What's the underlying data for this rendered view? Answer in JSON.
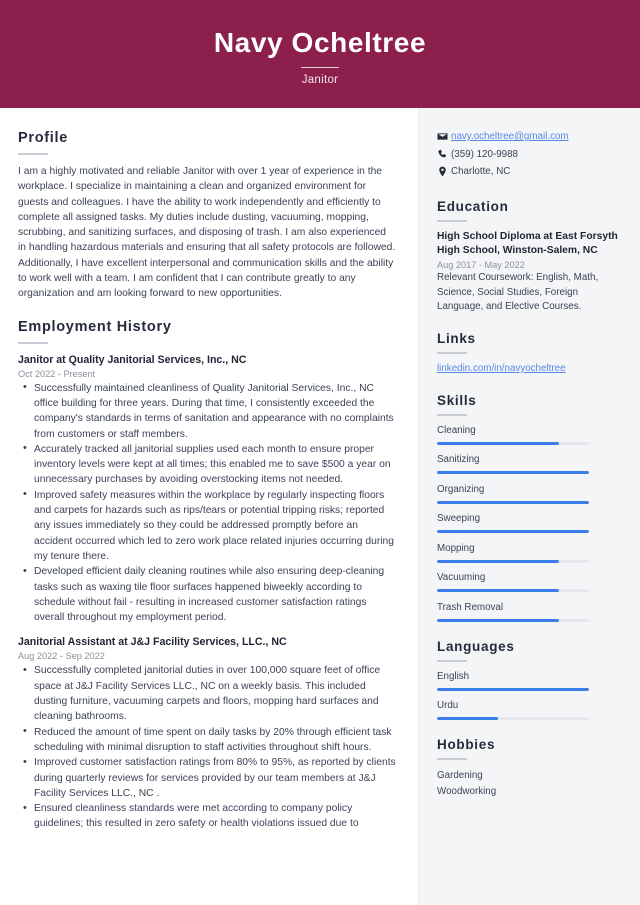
{
  "colors": {
    "header_band": "#8C1F4B",
    "accent_bar": "#3B7DEA",
    "bar_track": "#E5E7EA",
    "sidebar_bg": "#F4F5F7",
    "heading": "#262B3B",
    "body_text": "#3C4356",
    "muted_text": "#8C919E",
    "link": "#5588E6"
  },
  "header": {
    "name": "Navy Ocheltree",
    "role": "Janitor"
  },
  "main": {
    "profile": {
      "title": "Profile",
      "text": "I am a highly motivated and reliable Janitor with over 1 year of experience in the workplace. I specialize in maintaining a clean and organized environment for guests and colleagues. I have the ability to work independently and efficiently to complete all assigned tasks. My duties include dusting, vacuuming, mopping, scrubbing, and sanitizing surfaces, and disposing of trash. I am also experienced in handling hazardous materials and ensuring that all safety protocols are followed. Additionally, I have excellent interpersonal and communication skills and the ability to work well with a team. I am confident that I can contribute greatly to any organization and am looking forward to new opportunities."
    },
    "employment": {
      "title": "Employment History",
      "jobs": [
        {
          "title": "Janitor at Quality Janitorial Services, Inc., NC",
          "date": "Oct 2022 - Present",
          "bullets": [
            "Successfully maintained cleanliness of Quality Janitorial Services, Inc., NC office building for three years. During that time, I consistently exceeded the company's standards in terms of sanitation and appearance with no complaints from customers or staff members.",
            "Accurately tracked all janitorial supplies used each month to ensure proper inventory levels were kept at all times; this enabled me to save $500 a year on unnecessary purchases by avoiding overstocking items not needed.",
            "Improved safety measures within the workplace by regularly inspecting floors and carpets for hazards such as rips/tears or potential tripping risks; reported any issues immediately so they could be addressed promptly before an accident occurred which led to zero work place related injuries occurring during my tenure there.",
            "Developed efficient daily cleaning routines while also ensuring deep-cleaning tasks such as waxing tile floor surfaces happened biweekly according to schedule without fail - resulting in increased customer satisfaction ratings overall throughout my employment period."
          ]
        },
        {
          "title": "Janitorial Assistant at J&J Facility Services, LLC., NC",
          "date": "Aug 2022 - Sep 2022",
          "bullets": [
            "Successfully completed janitorial duties in over 100,000 square feet of office space at J&J Facility Services LLC., NC on a weekly basis. This included dusting furniture, vacuuming carpets and floors, mopping hard surfaces and cleaning bathrooms.",
            "Reduced the amount of time spent on daily tasks by 20% through efficient task scheduling with minimal disruption to staff activities throughout shift hours.",
            "Improved customer satisfaction ratings from 80% to 95%, as reported by clients during quarterly reviews for services provided by our team members at J&J Facility Services LLC., NC .",
            "Ensured cleanliness standards were met according to company policy guidelines; this resulted in zero safety or health violations issued due to"
          ]
        }
      ]
    }
  },
  "sidebar": {
    "contact": [
      {
        "icon": "envelope-icon",
        "value": "navy.ocheltree@gmail.com",
        "is_link": true
      },
      {
        "icon": "phone-icon",
        "value": "(359) 120-9988",
        "is_link": false
      },
      {
        "icon": "location-pin-icon",
        "value": "Charlotte, NC",
        "is_link": false
      }
    ],
    "education": {
      "title": "Education",
      "entries": [
        {
          "degree": "High School Diploma at East Forsyth High School, Winston-Salem, NC",
          "date": "Aug 2017 - May 2022",
          "description": "Relevant Coursework: English, Math, Science, Social Studies, Foreign Language, and Elective Courses."
        }
      ]
    },
    "links": {
      "title": "Links",
      "items": [
        {
          "label": "linkedin.com/in/navyocheltree"
        }
      ]
    },
    "skills": {
      "title": "Skills",
      "items": [
        {
          "label": "Cleaning",
          "level": 80
        },
        {
          "label": "Sanitizing",
          "level": 100
        },
        {
          "label": "Organizing",
          "level": 100
        },
        {
          "label": "Sweeping",
          "level": 100
        },
        {
          "label": "Mopping",
          "level": 80
        },
        {
          "label": "Vacuuming",
          "level": 80
        },
        {
          "label": "Trash Removal",
          "level": 80
        }
      ]
    },
    "languages": {
      "title": "Languages",
      "items": [
        {
          "label": "English",
          "level": 100
        },
        {
          "label": "Urdu",
          "level": 40
        }
      ]
    },
    "hobbies": {
      "title": "Hobbies",
      "items": [
        {
          "label": "Gardening"
        },
        {
          "label": "Woodworking"
        }
      ]
    }
  }
}
